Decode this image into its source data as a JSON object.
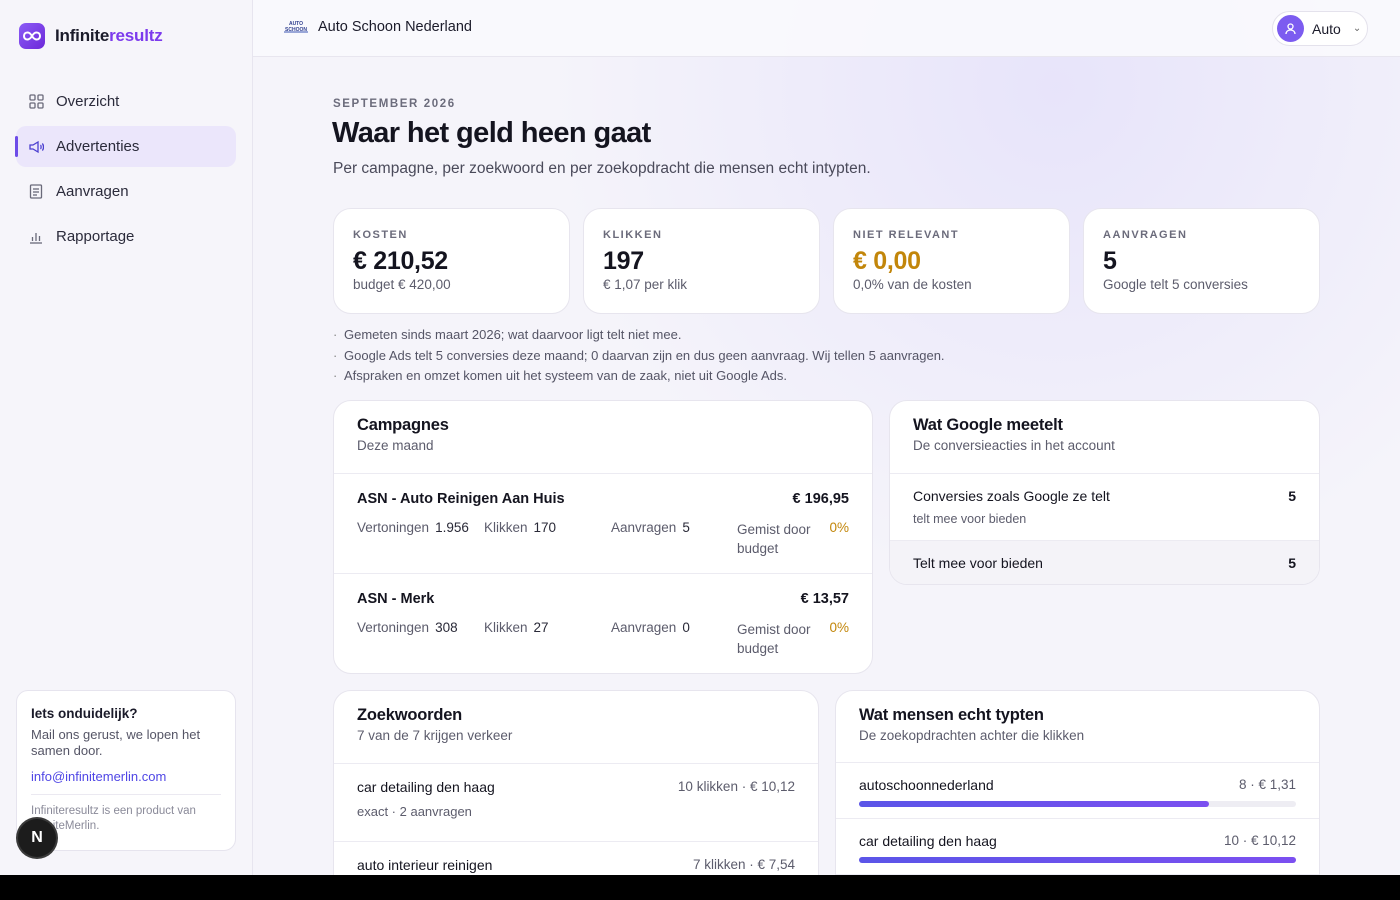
{
  "brand": {
    "name_main": "Infinite",
    "name_accent": "resultz"
  },
  "nav": [
    {
      "label": "Overzicht",
      "icon": "grid-icon",
      "active": false
    },
    {
      "label": "Advertenties",
      "icon": "megaphone-icon",
      "active": true
    },
    {
      "label": "Aanvragen",
      "icon": "form-icon",
      "active": false
    },
    {
      "label": "Rapportage",
      "icon": "bar-chart-icon",
      "active": false
    }
  ],
  "help": {
    "title": "Iets onduidelijk?",
    "text": "Mail ons gerust, we lopen het samen door.",
    "email": "info@infinitemerlin.com",
    "footer": "Infiniteresultz is een product van InfiniteMerlin."
  },
  "avatar_letter": "N",
  "topbar": {
    "client_logo_text": "AUTO SCHOON",
    "client_name": "Auto Schoon Nederland",
    "user_label": "Auto"
  },
  "header": {
    "kicker": "SEPTEMBER 2026",
    "title": "Waar het geld heen gaat",
    "subtitle": "Per campagne, per zoekwoord en per zoekopdracht die mensen echt intypten."
  },
  "stats": [
    {
      "label": "KOSTEN",
      "value": "€ 210,52",
      "sub": "budget € 420,00",
      "warn": false
    },
    {
      "label": "KLIKKEN",
      "value": "197",
      "sub": "€ 1,07 per klik",
      "warn": false
    },
    {
      "label": "NIET RELEVANT",
      "value": "€ 0,00",
      "sub": "0,0% van de kosten",
      "warn": true
    },
    {
      "label": "AANVRAGEN",
      "value": "5",
      "sub": "Google telt 5 conversies",
      "warn": false
    }
  ],
  "notes": [
    "Gemeten sinds maart 2026; wat daarvoor ligt telt niet mee.",
    "Google Ads telt 5 conversies deze maand; 0 daarvan zijn en dus geen aanvraag. Wij tellen 5 aanvragen.",
    "Afspraken en omzet komen uit het systeem van de zaak, niet uit Google Ads."
  ],
  "campaigns": {
    "title": "Campagnes",
    "subtitle": "Deze maand",
    "labels": {
      "impressions": "Vertoningen",
      "clicks": "Klikken",
      "requests": "Aanvragen",
      "missed": "Gemist door budget"
    },
    "rows": [
      {
        "name": "ASN - Auto Reinigen Aan Huis",
        "cost": "€ 196,95",
        "impressions": "1.956",
        "clicks": "170",
        "requests": "5",
        "missed": "0%"
      },
      {
        "name": "ASN - Merk",
        "cost": "€ 13,57",
        "impressions": "308",
        "clicks": "27",
        "requests": "0",
        "missed": "0%"
      }
    ]
  },
  "google": {
    "title": "Wat Google meetelt",
    "subtitle": "De conversieacties in het account",
    "rows": [
      {
        "label": "Conversies zoals Google ze telt",
        "sub": "telt mee voor bieden",
        "value": "5"
      },
      {
        "label": "Telt mee voor bieden",
        "value": "5"
      }
    ]
  },
  "keywords": {
    "title": "Zoekwoorden",
    "subtitle": "7 van de 7 krijgen verkeer",
    "rows": [
      {
        "name": "car detailing den haag",
        "meta": "exact · 2 aanvragen",
        "stat": "10 klikken · € 10,12"
      },
      {
        "name": "auto interieur reinigen",
        "meta": "",
        "stat": "7 klikken · € 7,54"
      }
    ]
  },
  "queries": {
    "title": "Wat mensen echt typten",
    "subtitle": "De zoekopdrachten achter die klikken",
    "rows": [
      {
        "name": "autoschoonnederland",
        "stat": "8 · € 1,31",
        "share": 0.8
      },
      {
        "name": "car detailing den haag",
        "stat": "10 · € 10,12",
        "share": 1.0
      }
    ]
  }
}
